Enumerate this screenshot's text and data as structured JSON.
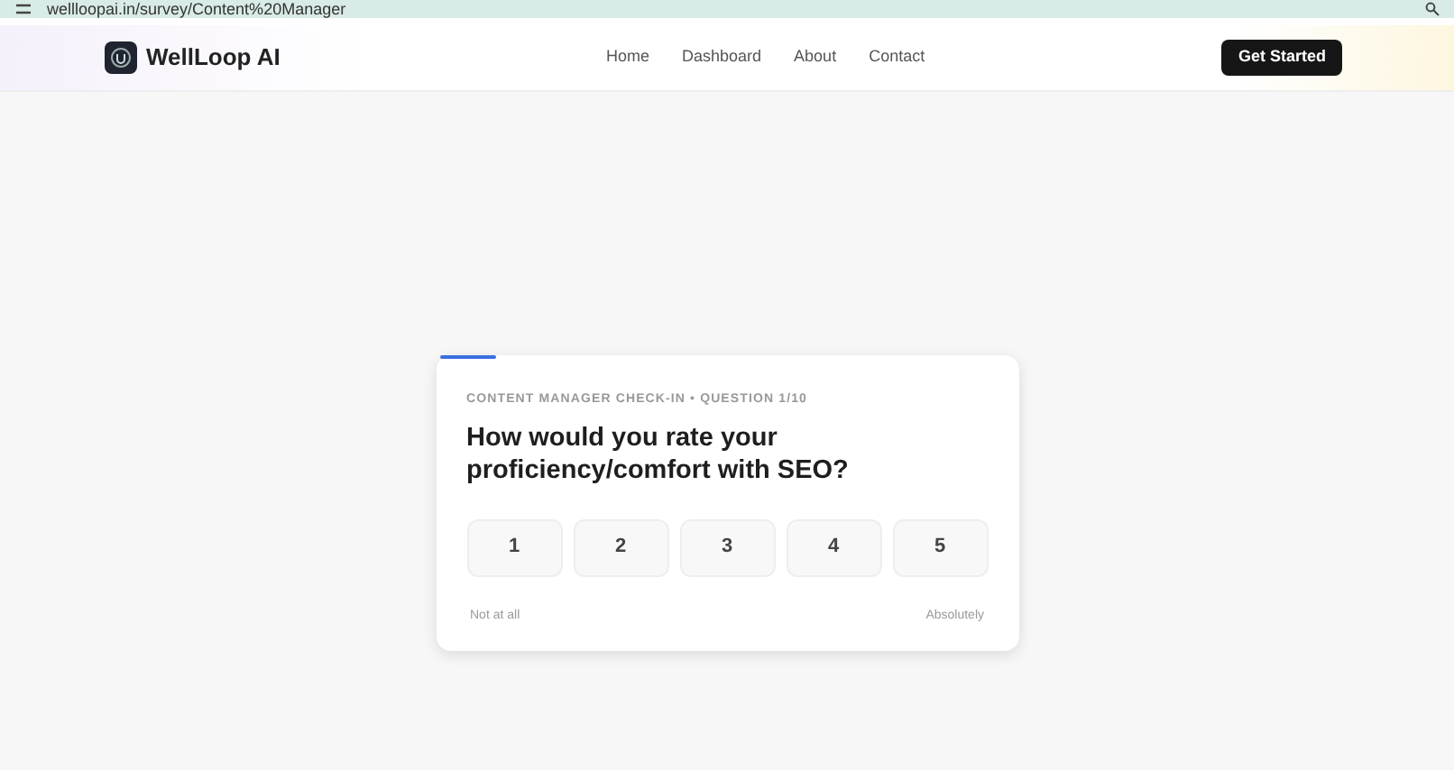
{
  "browser": {
    "url": "wellloopai.in/survey/Content%20Manager"
  },
  "nav": {
    "brand": "WellLoop AI",
    "links": [
      "Home",
      "Dashboard",
      "About",
      "Contact"
    ],
    "cta": "Get Started"
  },
  "survey": {
    "progress": {
      "level": 0.1
    },
    "eyebrow": "CONTENT MANAGER CHECK-IN • QUESTION 1/10",
    "question": "How would you rate your proficiency/comfort with SEO?",
    "options": [
      {
        "label": "1",
        "selected": false
      },
      {
        "label": "2",
        "selected": false
      },
      {
        "label": "3",
        "selected": false
      },
      {
        "label": "4",
        "selected": false
      },
      {
        "label": "5",
        "selected": false
      }
    ],
    "scale_low": "Not at all",
    "scale_high": "Absolutely"
  }
}
